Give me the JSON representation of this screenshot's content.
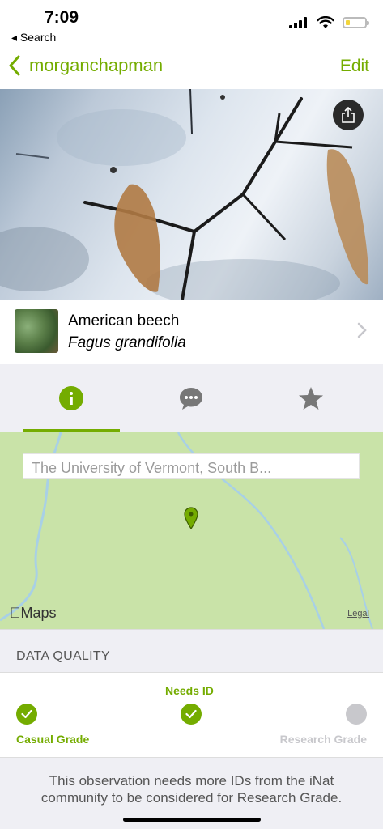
{
  "status_bar": {
    "time": "7:09",
    "back_label": "◂ Search"
  },
  "nav": {
    "title": "morganchapman",
    "edit_label": "Edit"
  },
  "taxon": {
    "common_name": "American beech",
    "scientific_name": "Fagus grandifolia"
  },
  "tabs": [
    {
      "name": "info",
      "icon": "info-icon",
      "selected": true
    },
    {
      "name": "activity",
      "icon": "chat-icon",
      "selected": false
    },
    {
      "name": "favorites",
      "icon": "star-icon",
      "selected": false
    }
  ],
  "map": {
    "location_text": "The University of Vermont, South B...",
    "provider_label": "Maps",
    "legal_label": "Legal"
  },
  "data_quality": {
    "header": "DATA QUALITY",
    "current_label": "Needs ID",
    "casual_label": "Casual Grade",
    "research_label": "Research Grade",
    "explanation": "This observation needs more IDs from the iNat community to be considered for Research Grade."
  },
  "colors": {
    "accent": "#74ac00",
    "inactive": "#c8c8cc",
    "map": "#c9e3a8"
  }
}
